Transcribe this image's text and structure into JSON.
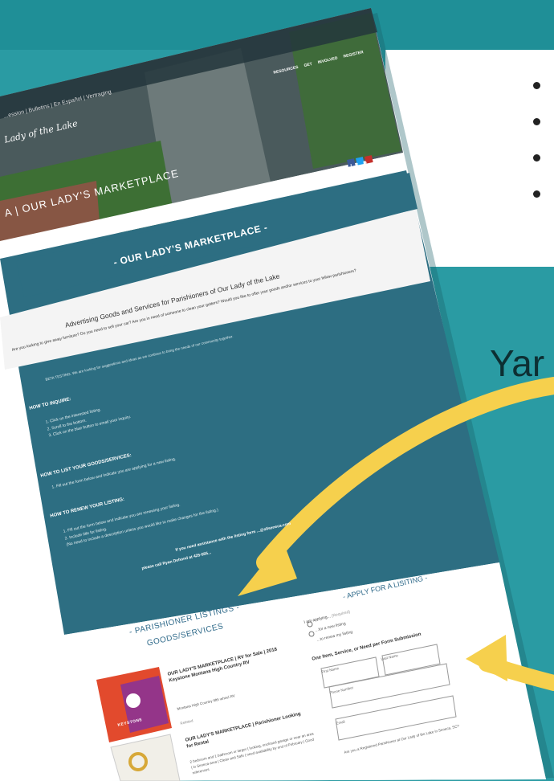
{
  "brand": {
    "script_logo": "Lady of the Lake"
  },
  "hero": {
    "topbar_text": "...ession | Bulletins | En Español | Vertraging",
    "nav_items": [
      "RESOURCES",
      "GET INVOLVED",
      "REGISTER"
    ],
    "page_title": "A | OUR LADY'S MARKETPLACE"
  },
  "panel": {
    "heading": "- OUR LADY'S MARKETPLACE -",
    "subheading": "Advertising Goods and Services for Parishioners of Our Lady of the Lake",
    "intro": "Are you looking to give away furniture? Do you need to sell your car? Are you in need of someone to clean your gutters? Would you like to offer your goods and/or services to your fellow parishioners?",
    "beta_note": "BETA TESTING. We are looking for suggestions and ideas as we continue to bring the needs of our community together.",
    "inquire_title": "HOW TO INQUIRE:",
    "inquire_steps": [
      "1. Click on the interested listing.",
      "2. Scroll to the bottom.",
      "3. Click on the blue button to email your inquiry."
    ],
    "list_title": "HOW TO LIST YOUR GOODS/SERVICES:",
    "list_steps": [
      "1. Fill out the form below and indicate you are applying for a new listing."
    ],
    "renew_title": "HOW TO RENEW YOUR LISTING:",
    "renew_steps": [
      "1. Fill out the form below and indicate you are renewing your listing.",
      "2. Include title for listing.",
      "(No need to include a description unless you would like to make changes for the listing.)"
    ],
    "assistance_line1": "If you need assistance with the listing form",
    "assistance_email": "...@ollseneca.com",
    "assistance_line2": "please call Ryan Dehond at 425-555..."
  },
  "listings": {
    "heading": "- PARISHIONER LISTINGS -",
    "subheading": "GOODS/SERVICES",
    "items": [
      {
        "title": "OUR LADY'S MARKETPLACE | RV for Sale | 2018 Keystone Montana High Country RV",
        "meta": "Montana High Country fifth wheel RV",
        "extra": "Relisted",
        "badge": "KEYSTONE"
      },
      {
        "title": "OUR LADY'S MARKETPLACE | Parishioner Looking for Rental",
        "meta": "2 bedroom and 1 bathroom or larger | looking, enclosed garage or near an area | in Seneca area | Clean and Safe | need availability by end of February | Good references",
        "extra": "",
        "badge": ""
      }
    ]
  },
  "form": {
    "heading": "- APPLY FOR A LISITING -",
    "applying_label": "I am applying...",
    "required_tag": "(Required)",
    "option_new": "...for a new listing",
    "option_renew": "...to renew my listing",
    "rule": "One Item, Service, or Need per Form Submission",
    "first_name_label": "First Name",
    "last_name_label": "Last Name",
    "phone_label": "Phone Number",
    "email_label": "Email",
    "registered_question": "Are you a Registered Parishioner at Our Lady of the Lake in Seneca, SC?"
  },
  "page_right": {
    "partial_word": "Yar"
  },
  "social": {
    "labels": [
      "f",
      "t",
      "in"
    ]
  },
  "colors": {
    "teal_bg": "#2a9ba3",
    "panel": "#2d6e82",
    "accent_yellow": "#f6d04d",
    "listing_blue": "#2f6a8a"
  },
  "icons": [
    "search-icon",
    "facebook-icon",
    "twitter-icon",
    "email-icon",
    "radio-icon",
    "logo-keystone",
    "keys-icon",
    "arrow-icon"
  ]
}
